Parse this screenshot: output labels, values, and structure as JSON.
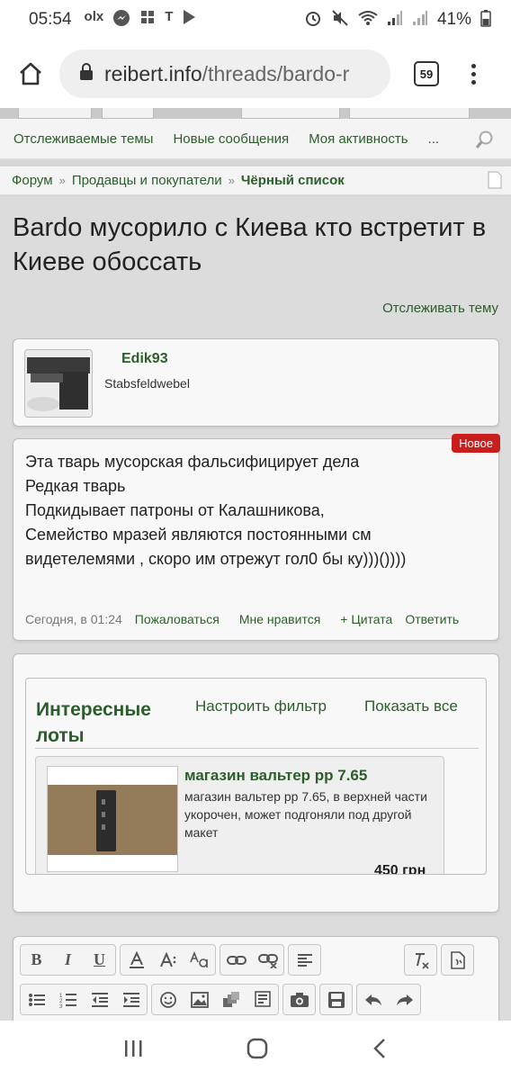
{
  "status_bar": {
    "time": "05:54",
    "notif_icons": [
      "olx-icon",
      "messenger-icon",
      "grid-app-icon",
      "t-app-icon",
      "play-store-icon"
    ],
    "battery": "41%"
  },
  "browser": {
    "url_host": "reibert.info",
    "url_path": "/threads/bardo-r",
    "tab_count": "59"
  },
  "quick_nav": {
    "items": [
      "Отслеживаемые темы",
      "Новые сообщения",
      "Моя активность",
      "..."
    ]
  },
  "breadcrumb": {
    "items": [
      "Форум",
      "Продавцы и покупатели"
    ],
    "separator": "»",
    "current": "Чёрный список"
  },
  "thread": {
    "title": "Bardo мусорило с Киева кто встретит в Киеве обоссать",
    "watch_label": "Отслеживать тему"
  },
  "author": {
    "username": "Edik93",
    "rank": "Stabsfeldwebel"
  },
  "post": {
    "badge": "Новое",
    "lines": [
      "Эта тварь мусорская фальсифицирует дела",
      "Редкая тварь",
      "Подкидывает патроны от Калашникова,",
      "Семейство мразей являются постоянными см",
      "видетелемями , скоро им отрежут гол0 бы ку)))())))"
    ],
    "date": "Сегодня, в 01:24",
    "actions": {
      "report": "Пожаловаться",
      "like": "Мне нравится",
      "quote": "+ Цитата",
      "reply": "Ответить"
    }
  },
  "lots": {
    "title": "Интересные лоты",
    "filter_label": "Настроить фильтр",
    "show_all_label": "Показать все",
    "items": [
      {
        "name": "магазин вальтер pp 7.65",
        "description": "магазин вальтер pp 7.65, в верхней части укорочен, может подгоняли под другой макет",
        "price": "450 грн"
      }
    ]
  },
  "editor": {
    "row1": [
      "bold-icon",
      "italic-icon",
      "underline-icon",
      "text-color-icon",
      "font-size-icon",
      "font-family-icon",
      "link-icon",
      "unlink-icon",
      "align-icon",
      "remove-format-icon",
      "toggle-bbcode-icon"
    ],
    "row2": [
      "bullet-list-icon",
      "numbered-list-icon",
      "outdent-icon",
      "indent-icon",
      "smilie-icon",
      "image-icon",
      "media-icon",
      "quote-icon",
      "camera-icon",
      "save-icon",
      "undo-icon",
      "redo-icon"
    ],
    "bold_label": "B",
    "italic_label": "I",
    "underline_label": "U"
  },
  "colors": {
    "link_green": "#2b5e2b",
    "badge_red": "#c81e1e",
    "page_bg": "#d6d6d6",
    "card_bg": "#f8f8f8"
  }
}
